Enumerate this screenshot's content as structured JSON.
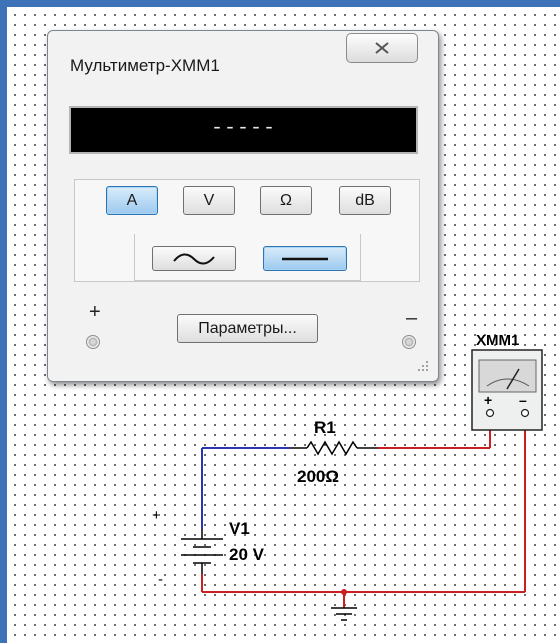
{
  "multimeter": {
    "title": "Мультиметр-XMM1",
    "readout": "-----",
    "mode_buttons": [
      "A",
      "V",
      "Ω",
      "dB"
    ],
    "active_mode": "A",
    "signal": "dc",
    "settings_button": "Параметры...",
    "plus_label": "+",
    "minus_label": "–"
  },
  "circuit": {
    "instrument_label": "XMM1",
    "instrument_plus": "+",
    "instrument_minus": "–",
    "resistor_name": "R1",
    "resistor_value": "200Ω",
    "source_name": "V1",
    "source_value": "20 V",
    "source_plus": "+",
    "source_minus": "-"
  },
  "colors": {
    "frame": "#3f73b8",
    "wire_positive": "#cc1f1f",
    "wire_negative": "#2a35b5",
    "active_button": "#9cc9ef"
  }
}
